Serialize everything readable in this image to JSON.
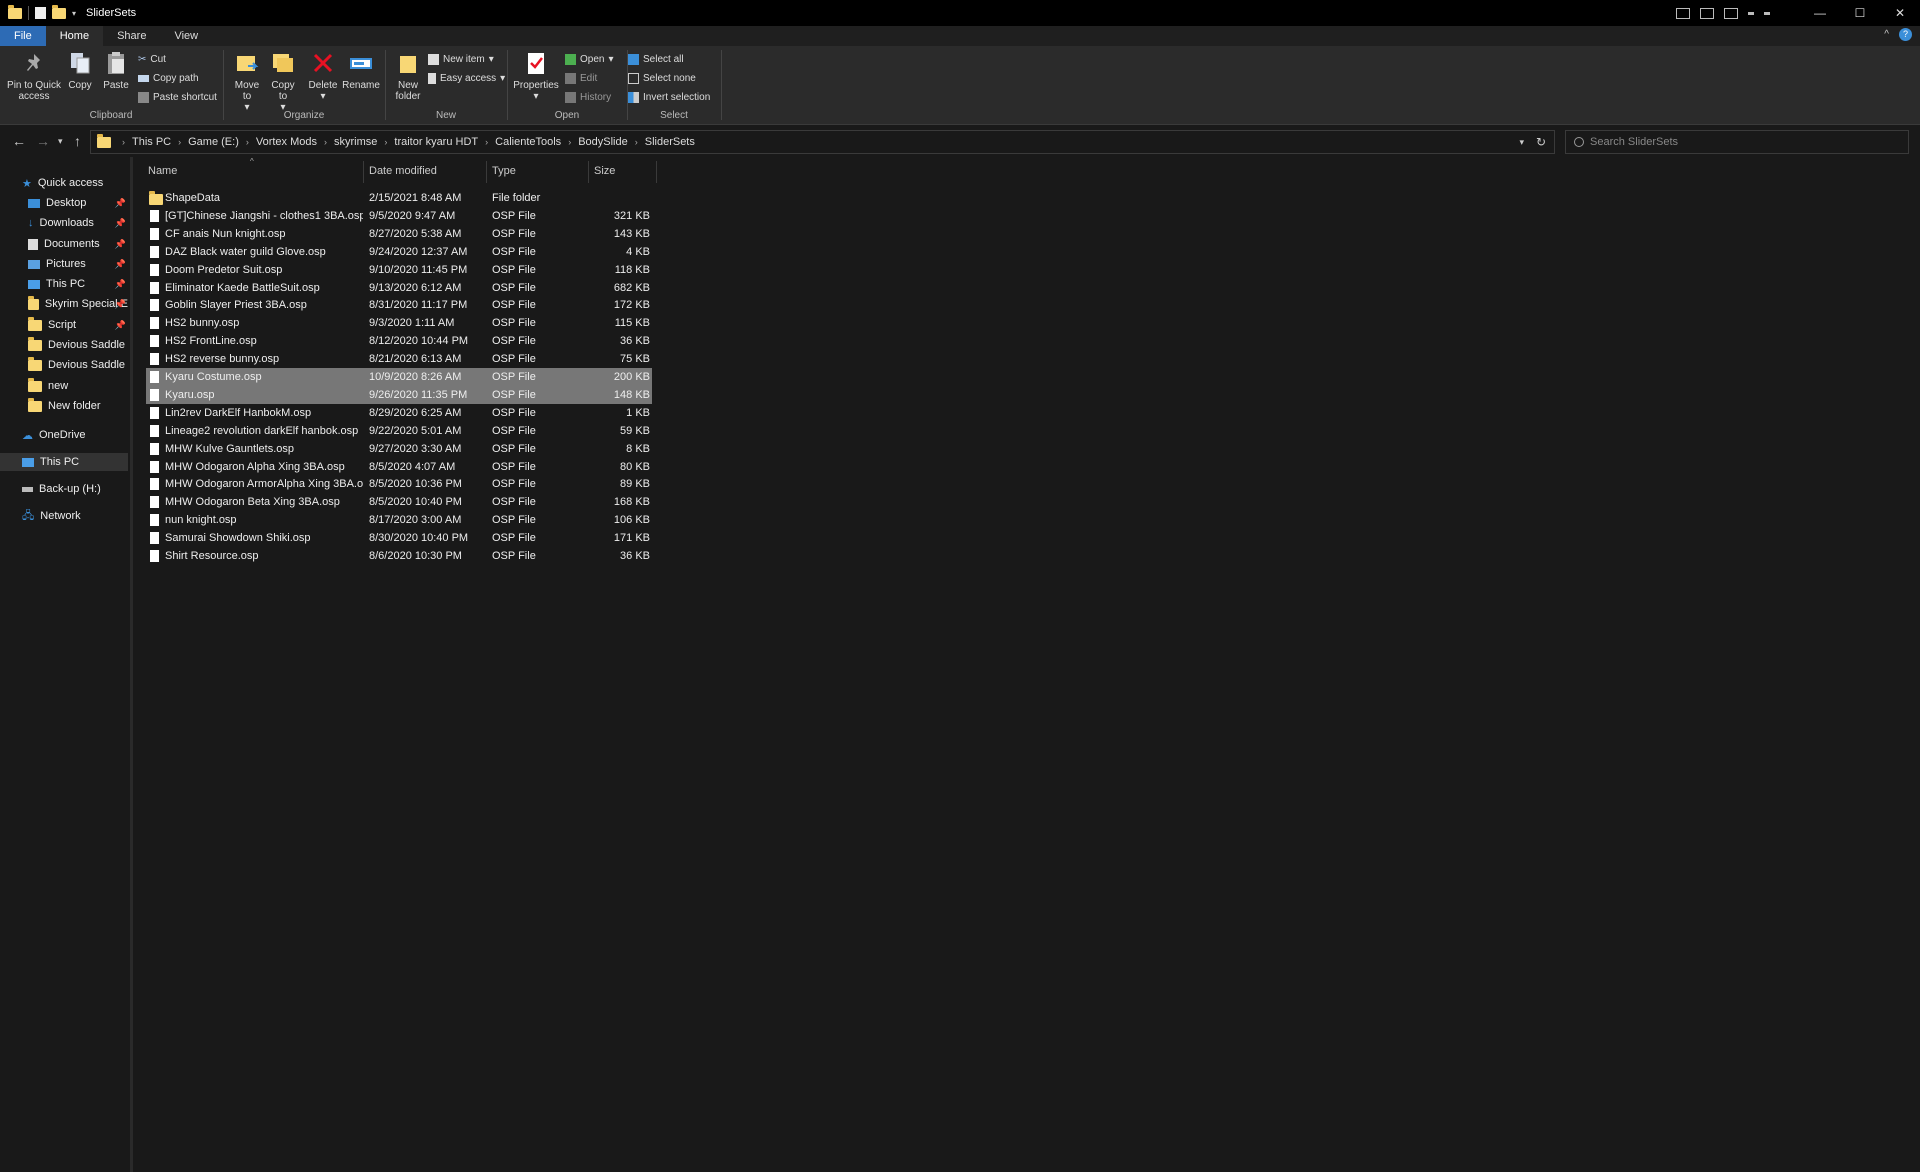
{
  "window": {
    "title": "SliderSets",
    "controls": {
      "minimize": "—",
      "maximize": "☐",
      "close": "✕"
    }
  },
  "tabs": {
    "file": "File",
    "home": "Home",
    "share": "Share",
    "view": "View"
  },
  "ribbon": {
    "clipboard": {
      "label": "Clipboard",
      "pin": "Pin to Quick access",
      "copy": "Copy",
      "paste": "Paste",
      "cut": "Cut",
      "copy_path": "Copy path",
      "paste_shortcut": "Paste shortcut"
    },
    "organize": {
      "label": "Organize",
      "move_to": "Move to",
      "copy_to": "Copy to",
      "delete": "Delete",
      "rename": "Rename"
    },
    "new": {
      "label": "New",
      "new_folder": "New folder",
      "new_item": "New item",
      "easy_access": "Easy access"
    },
    "open": {
      "label": "Open",
      "properties": "Properties",
      "open": "Open",
      "edit": "Edit",
      "history": "History"
    },
    "select": {
      "label": "Select",
      "select_all": "Select all",
      "select_none": "Select none",
      "invert": "Invert selection"
    }
  },
  "address": {
    "crumbs": [
      "This PC",
      "Game (E:)",
      "Vortex Mods",
      "skyrimse",
      "traitor kyaru HDT",
      "CalienteTools",
      "BodySlide",
      "SliderSets"
    ],
    "search_placeholder": "Search SliderSets"
  },
  "sidebar": {
    "quick_access": "Quick access",
    "items": [
      {
        "label": "Desktop",
        "pinned": true
      },
      {
        "label": "Downloads",
        "pinned": true
      },
      {
        "label": "Documents",
        "pinned": true
      },
      {
        "label": "Pictures",
        "pinned": true
      },
      {
        "label": "This PC",
        "pinned": true
      },
      {
        "label": "Skyrim Special E",
        "pinned": true
      },
      {
        "label": "Script",
        "pinned": true
      },
      {
        "label": "Devious Saddle",
        "pinned": false
      },
      {
        "label": "Devious Saddle",
        "pinned": false
      },
      {
        "label": "new",
        "pinned": false
      },
      {
        "label": "New folder",
        "pinned": false
      }
    ],
    "onedrive": "OneDrive",
    "this_pc": "This PC",
    "backup": "Back-up (H:)",
    "network": "Network"
  },
  "columns": {
    "name": "Name",
    "date": "Date modified",
    "type": "Type",
    "size": "Size"
  },
  "files": [
    {
      "name": "ShapeData",
      "date": "2/15/2021 8:48 AM",
      "type": "File folder",
      "size": "",
      "folder": true
    },
    {
      "name": "[GT]Chinese Jiangshi - clothes1 3BA.osp",
      "date": "9/5/2020 9:47 AM",
      "type": "OSP File",
      "size": "321 KB"
    },
    {
      "name": "CF anais Nun knight.osp",
      "date": "8/27/2020 5:38 AM",
      "type": "OSP File",
      "size": "143 KB"
    },
    {
      "name": "DAZ Black water guild Glove.osp",
      "date": "9/24/2020 12:37 AM",
      "type": "OSP File",
      "size": "4 KB"
    },
    {
      "name": "Doom Predetor Suit.osp",
      "date": "9/10/2020 11:45 PM",
      "type": "OSP File",
      "size": "118 KB"
    },
    {
      "name": "Eliminator Kaede BattleSuit.osp",
      "date": "9/13/2020 6:12 AM",
      "type": "OSP File",
      "size": "682 KB"
    },
    {
      "name": "Goblin Slayer Priest 3BA.osp",
      "date": "8/31/2020 11:17 PM",
      "type": "OSP File",
      "size": "172 KB"
    },
    {
      "name": "HS2 bunny.osp",
      "date": "9/3/2020 1:11 AM",
      "type": "OSP File",
      "size": "115 KB"
    },
    {
      "name": "HS2 FrontLine.osp",
      "date": "8/12/2020 10:44 PM",
      "type": "OSP File",
      "size": "36 KB"
    },
    {
      "name": "HS2 reverse bunny.osp",
      "date": "8/21/2020 6:13 AM",
      "type": "OSP File",
      "size": "75 KB"
    },
    {
      "name": "Kyaru Costume.osp",
      "date": "10/9/2020 8:26 AM",
      "type": "OSP File",
      "size": "200 KB",
      "selected": true
    },
    {
      "name": "Kyaru.osp",
      "date": "9/26/2020 11:35 PM",
      "type": "OSP File",
      "size": "148 KB",
      "selected": true
    },
    {
      "name": "Lin2rev DarkElf HanbokM.osp",
      "date": "8/29/2020 6:25 AM",
      "type": "OSP File",
      "size": "1 KB"
    },
    {
      "name": "Lineage2 revolution darkElf hanbok.osp",
      "date": "9/22/2020 5:01 AM",
      "type": "OSP File",
      "size": "59 KB"
    },
    {
      "name": "MHW Kulve Gauntlets.osp",
      "date": "9/27/2020 3:30 AM",
      "type": "OSP File",
      "size": "8 KB"
    },
    {
      "name": "MHW Odogaron Alpha Xing 3BA.osp",
      "date": "8/5/2020 4:07 AM",
      "type": "OSP File",
      "size": "80 KB"
    },
    {
      "name": "MHW Odogaron ArmorAlpha Xing 3BA.o...",
      "date": "8/5/2020 10:36 PM",
      "type": "OSP File",
      "size": "89 KB"
    },
    {
      "name": "MHW Odogaron Beta Xing 3BA.osp",
      "date": "8/5/2020 10:40 PM",
      "type": "OSP File",
      "size": "168 KB"
    },
    {
      "name": "nun knight.osp",
      "date": "8/17/2020 3:00 AM",
      "type": "OSP File",
      "size": "106 KB"
    },
    {
      "name": "Samurai Showdown Shiki.osp",
      "date": "8/30/2020 10:40 PM",
      "type": "OSP File",
      "size": "171 KB"
    },
    {
      "name": "Shirt Resource.osp",
      "date": "8/6/2020 10:30 PM",
      "type": "OSP File",
      "size": "36 KB"
    }
  ],
  "colors": {
    "folder": "#f8d775",
    "accent": "#2d6bb5",
    "delete": "#e81123",
    "selection": "#777777"
  }
}
